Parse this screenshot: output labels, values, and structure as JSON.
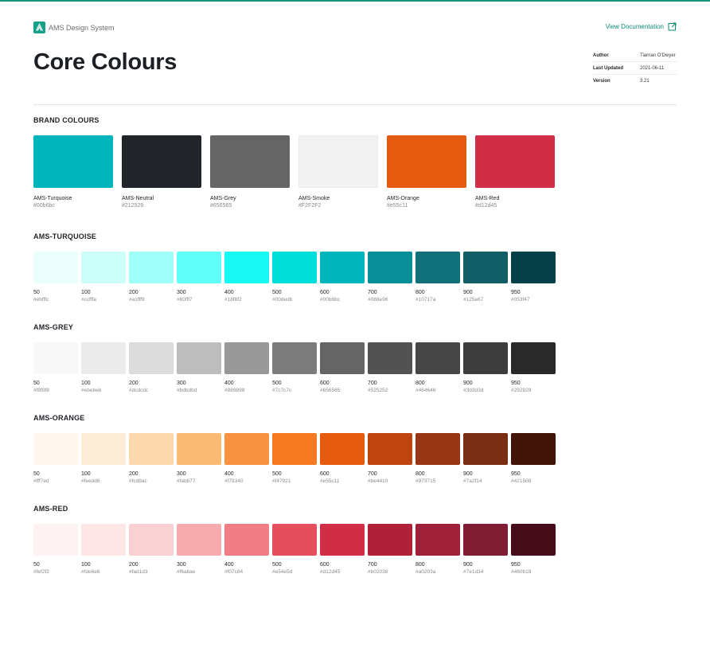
{
  "header": {
    "brand_name": "AMS Design System",
    "doc_link_label": "View Documentation"
  },
  "page": {
    "title": "Core Colours"
  },
  "meta": [
    {
      "key": "Author",
      "value": "Tiarnan O'Dwyer"
    },
    {
      "key": "Last Updated",
      "value": "2021-06-11"
    },
    {
      "key": "Version",
      "value": "3.21"
    }
  ],
  "accent_color": "#16967a",
  "brand_colours": {
    "title": "BRAND COLOURS",
    "items": [
      {
        "name": "AMS-Turquoise",
        "hex": "#00b6bc"
      },
      {
        "name": "AMS-Neutral",
        "hex": "#212529"
      },
      {
        "name": "AMS-Grey",
        "hex": "#656565"
      },
      {
        "name": "AMS-Smoke",
        "hex": "#F2F2F2"
      },
      {
        "name": "AMS-Orange",
        "hex": "#e55c11"
      },
      {
        "name": "AMS-Red",
        "hex": "#d12d45"
      }
    ]
  },
  "scales": [
    {
      "title": "AMS-TURQUOISE",
      "steps": [
        {
          "step": "50",
          "hex": "#ebfffc"
        },
        {
          "step": "100",
          "hex": "#ccfffa"
        },
        {
          "step": "200",
          "hex": "#a1fff9"
        },
        {
          "step": "300",
          "hex": "#60fff7"
        },
        {
          "step": "400",
          "hex": "#18f8f2"
        },
        {
          "step": "500",
          "hex": "#00dedb"
        },
        {
          "step": "600",
          "hex": "#00b6bc"
        },
        {
          "step": "700",
          "hex": "#088e96"
        },
        {
          "step": "800",
          "hex": "#10717a"
        },
        {
          "step": "900",
          "hex": "#125e67"
        },
        {
          "step": "950",
          "hex": "#053f47"
        }
      ]
    },
    {
      "title": "AMS-GREY",
      "steps": [
        {
          "step": "50",
          "hex": "#f8f8f8"
        },
        {
          "step": "100",
          "hex": "#ebebeb"
        },
        {
          "step": "200",
          "hex": "#dcdcdc"
        },
        {
          "step": "300",
          "hex": "#bdbdbd"
        },
        {
          "step": "400",
          "hex": "#989898"
        },
        {
          "step": "500",
          "hex": "#7c7c7c"
        },
        {
          "step": "600",
          "hex": "#656565"
        },
        {
          "step": "700",
          "hex": "#525252"
        },
        {
          "step": "800",
          "hex": "#464646"
        },
        {
          "step": "900",
          "hex": "#3d3d3d"
        },
        {
          "step": "950",
          "hex": "#292929"
        }
      ]
    },
    {
      "title": "AMS-ORANGE",
      "steps": [
        {
          "step": "50",
          "hex": "#fff7ed"
        },
        {
          "step": "100",
          "hex": "#feedd6"
        },
        {
          "step": "200",
          "hex": "#fcd8ac"
        },
        {
          "step": "300",
          "hex": "#fabb77"
        },
        {
          "step": "400",
          "hex": "#f79340"
        },
        {
          "step": "500",
          "hex": "#f47921"
        },
        {
          "step": "600",
          "hex": "#e55c11"
        },
        {
          "step": "700",
          "hex": "#be4410"
        },
        {
          "step": "800",
          "hex": "#973715"
        },
        {
          "step": "900",
          "hex": "#7a2f14"
        },
        {
          "step": "950",
          "hex": "#421508"
        }
      ]
    },
    {
      "title": "AMS-RED",
      "steps": [
        {
          "step": "50",
          "hex": "#fef2f2"
        },
        {
          "step": "100",
          "hex": "#fde6e6"
        },
        {
          "step": "200",
          "hex": "#fad1d3"
        },
        {
          "step": "300",
          "hex": "#f6abae"
        },
        {
          "step": "400",
          "hex": "#f07c84"
        },
        {
          "step": "500",
          "hex": "#e54e5d"
        },
        {
          "step": "600",
          "hex": "#d12d45"
        },
        {
          "step": "700",
          "hex": "#b02038"
        },
        {
          "step": "800",
          "hex": "#a0203a"
        },
        {
          "step": "900",
          "hex": "#7e1d34"
        },
        {
          "step": "950",
          "hex": "#460b18"
        }
      ]
    }
  ]
}
